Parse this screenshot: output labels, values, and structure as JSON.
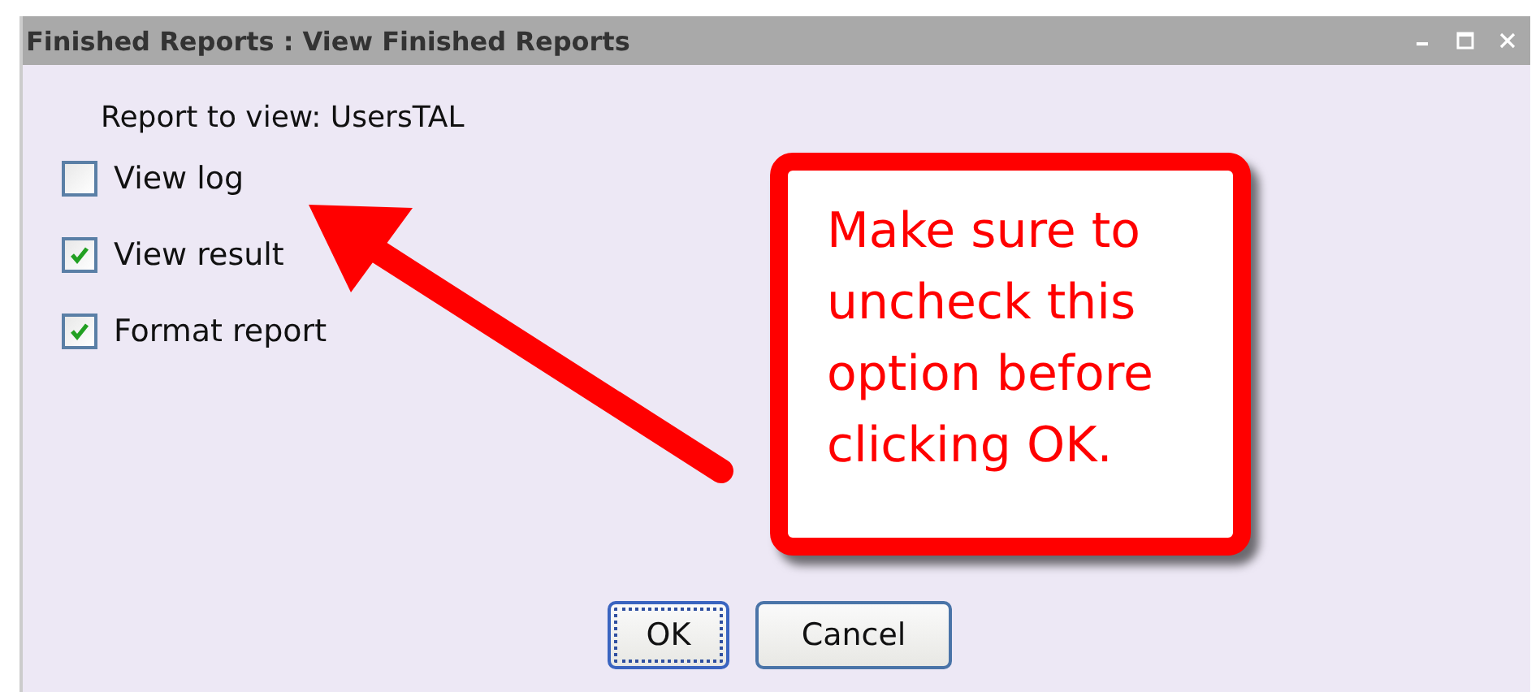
{
  "window": {
    "title": "Finished Reports : View Finished Reports"
  },
  "report_label": "Report to view: UsersTAL",
  "options": [
    {
      "label": "View log",
      "checked": false
    },
    {
      "label": "View result",
      "checked": true
    },
    {
      "label": "Format report",
      "checked": true
    }
  ],
  "callout": {
    "text": "Make sure to uncheck this option before clicking OK."
  },
  "buttons": [
    {
      "label": "OK",
      "selected": true
    },
    {
      "label": "Cancel",
      "selected": false
    }
  ]
}
